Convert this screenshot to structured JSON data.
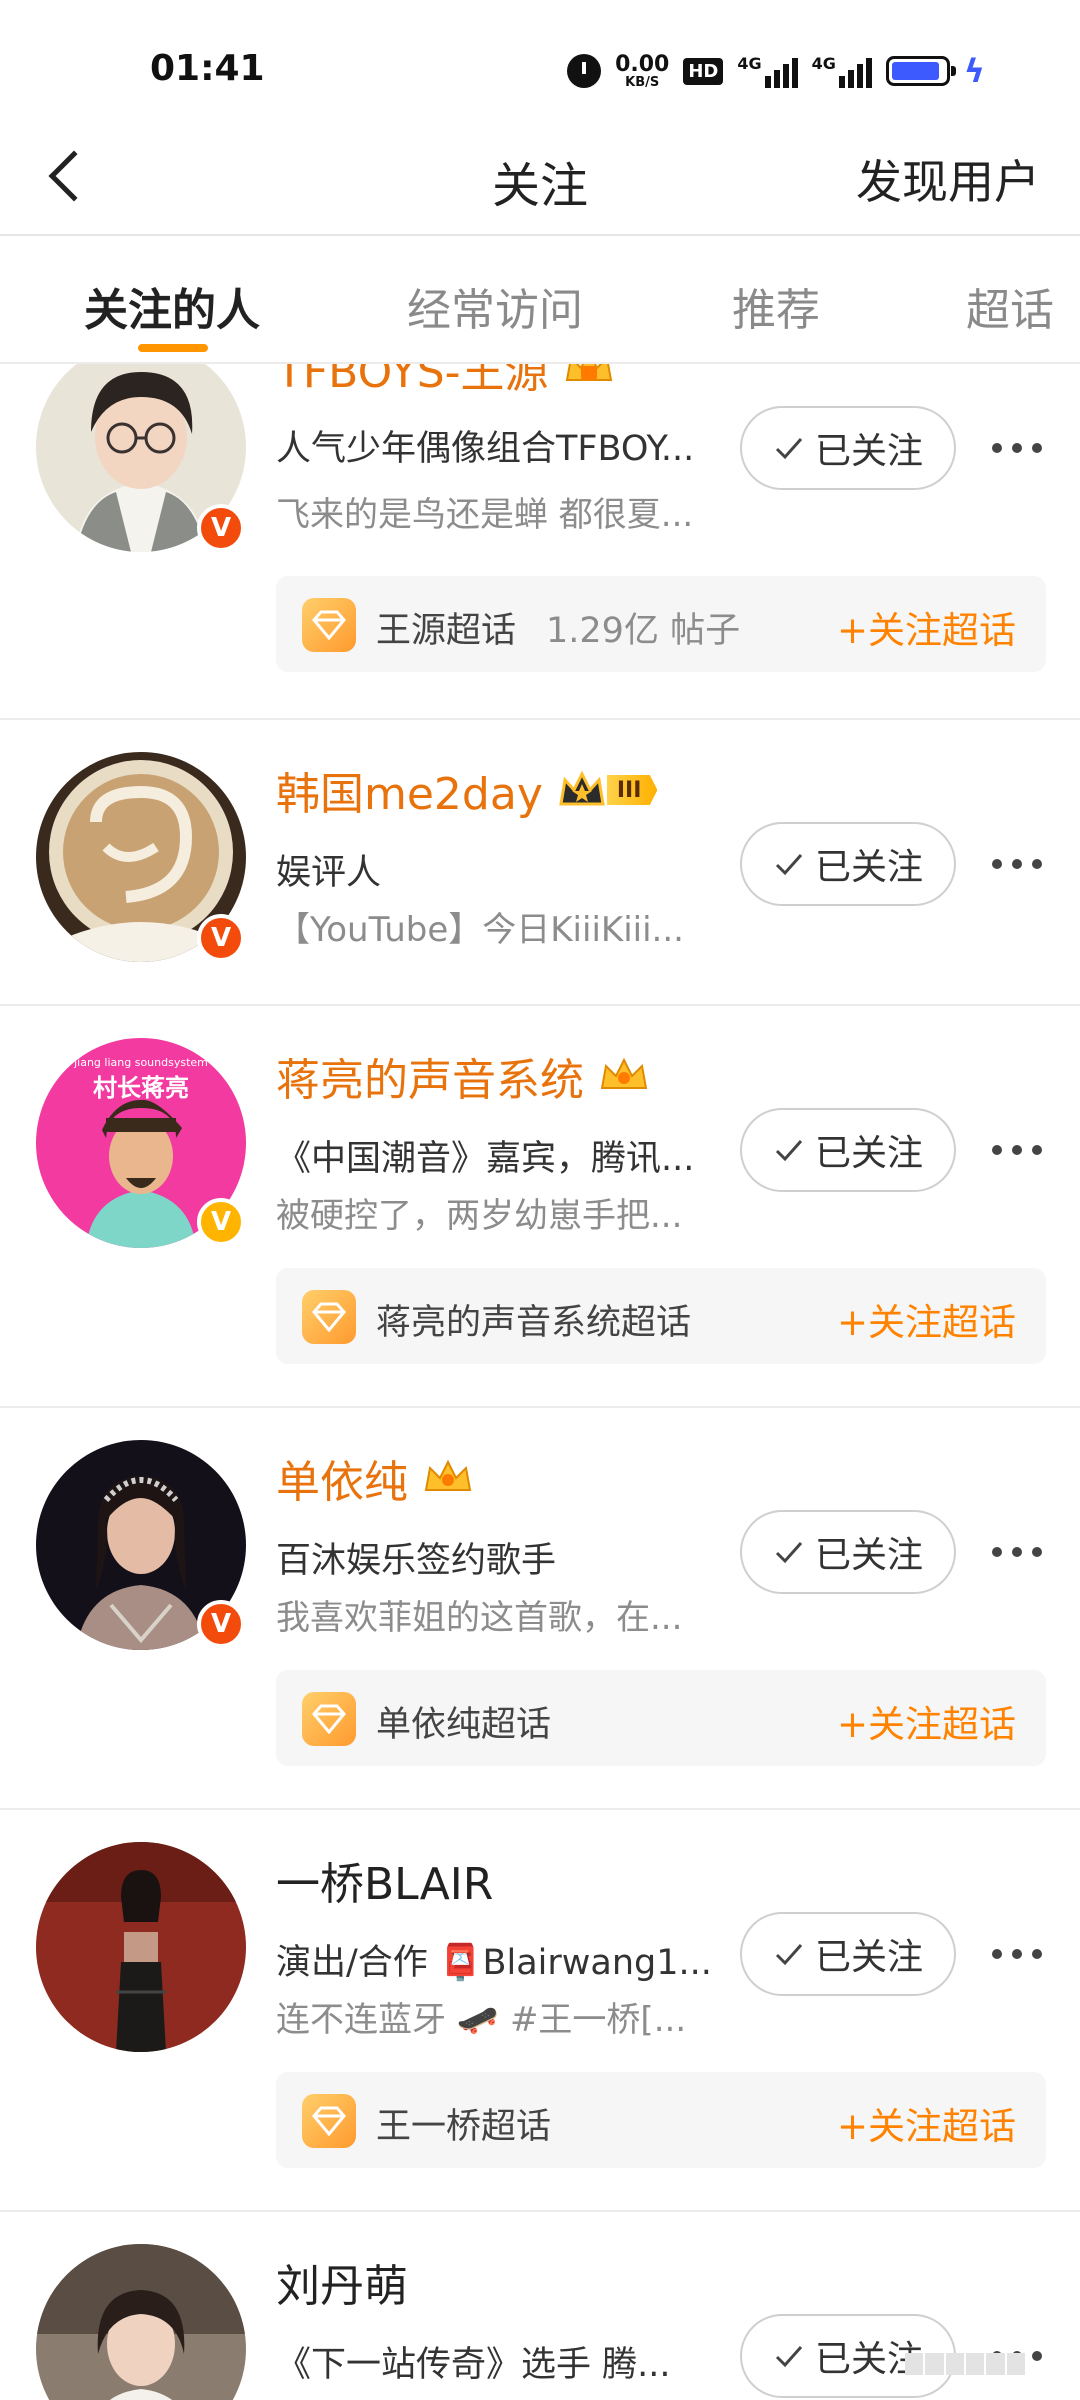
{
  "status_bar": {
    "time": "01:41",
    "net_speed": "0.00",
    "net_speed_unit": "KB/S",
    "hd_label": "HD",
    "sim1_label": "4G",
    "sim2_label": "4G",
    "battery_level": 0.9,
    "battery_color": "#3d5afe"
  },
  "nav": {
    "back_icon": "chevron-left-icon",
    "title": "关注",
    "right_action": "发现用户"
  },
  "tabs": [
    {
      "label": "关注的人",
      "active": true
    },
    {
      "label": "经常访问",
      "active": false
    },
    {
      "label": "推荐",
      "active": false
    },
    {
      "label": "超话",
      "active": false
    }
  ],
  "accent_color": "#ff9500",
  "users": [
    {
      "name": "TFBOYS-王源",
      "desc": "人气少年偶像组合TFBOY...",
      "post": "飞来的是鸟还是蝉 都很夏...",
      "follow_label": "已关注",
      "verified": "red",
      "topic": {
        "name": "王源超话",
        "count": "1.29亿 帖子",
        "follow_label": "+关注超话"
      }
    },
    {
      "name": "韩国me2day",
      "rank_label": "III",
      "desc": "娱评人",
      "post": "【YouTube】今日KiiiKiii...",
      "follow_label": "已关注",
      "verified": "red"
    },
    {
      "name": "蒋亮的声音系统",
      "avatar_caption_small": "jiang liang soundsystem",
      "avatar_caption": "村长蒋亮",
      "desc": "《中国潮音》嘉宾，腾讯...",
      "post": "被硬控了，两岁幼崽手把...",
      "follow_label": "已关注",
      "verified": "gold",
      "topic": {
        "name": "蒋亮的声音系统超话",
        "follow_label": "+关注超话"
      }
    },
    {
      "name": "单依纯",
      "desc": "百沐娱乐签约歌手",
      "post": "我喜欢菲姐的这首歌，在...",
      "follow_label": "已关注",
      "verified": "red",
      "topic": {
        "name": "单依纯超话",
        "follow_label": "+关注超话"
      }
    },
    {
      "name": "一桥BLAIR",
      "desc": "演出/合作 📮Blairwang1...",
      "post": "连不连蓝牙 🛹 #王一桥[...",
      "follow_label": "已关注",
      "topic": {
        "name": "王一桥超话",
        "follow_label": "+关注超话"
      }
    },
    {
      "name": "刘丹萌",
      "desc": "《下一站传奇》选手 腾...",
      "follow_label": "已关注"
    }
  ]
}
